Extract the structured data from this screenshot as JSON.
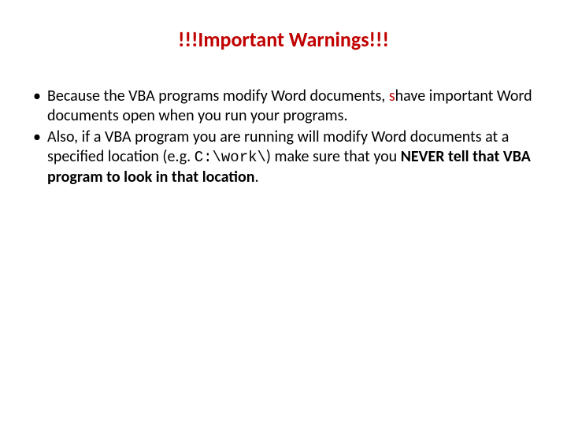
{
  "title": "!!!Important Warnings!!!",
  "bullets": {
    "b1": {
      "part1": "Because the VBA programs modify Word documents, ",
      "red": "s",
      "part2": "have important Word documents open when you run your programs."
    },
    "b2": {
      "part1": "Also, if a VBA program you are running will modify Word documents at a specified location (e.g. ",
      "code": "C:\\work\\",
      "part2": ") make sure that you ",
      "bold": "NEVER tell that VBA program to look in that location",
      "part3": "."
    }
  }
}
